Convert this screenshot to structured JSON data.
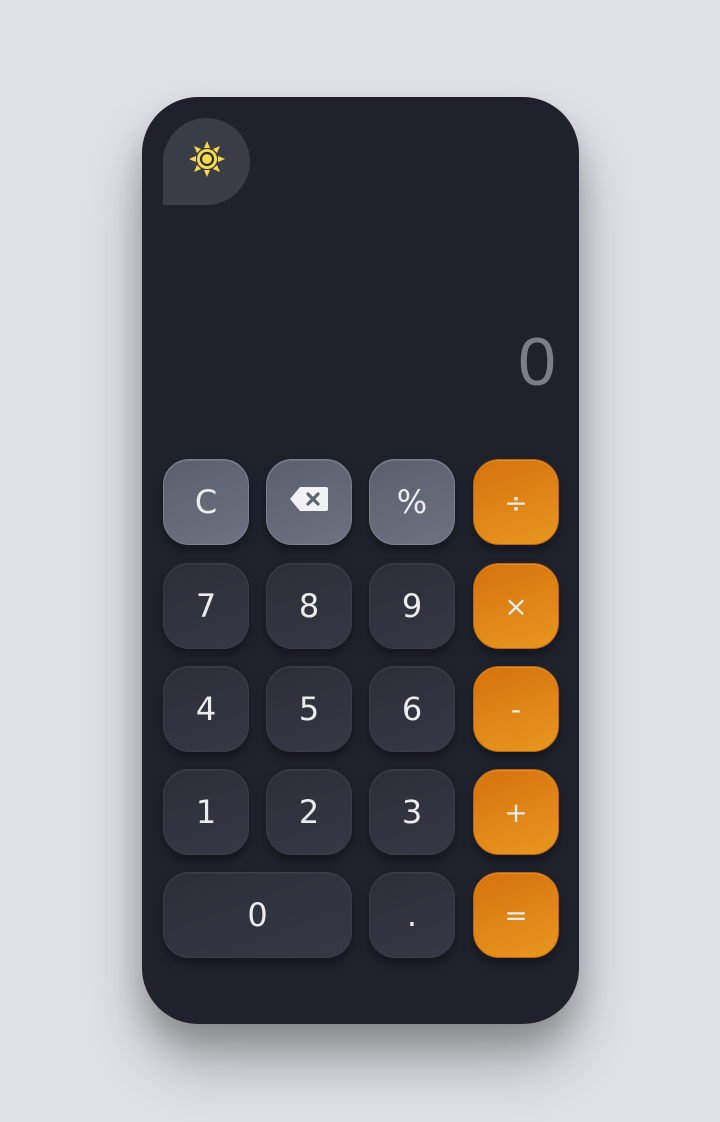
{
  "theme_toggle": {
    "icon": "sun-icon"
  },
  "display": {
    "value": "0"
  },
  "keys": {
    "clear": "C",
    "backspace_icon": "backspace-icon",
    "percent": "%",
    "divide": "÷",
    "seven": "7",
    "eight": "8",
    "nine": "9",
    "multiply": "×",
    "four": "4",
    "five": "5",
    "six": "6",
    "subtract": "-",
    "one": "1",
    "two": "2",
    "three": "3",
    "add": "+",
    "zero": "0",
    "decimal": ".",
    "equals": "="
  },
  "colors": {
    "background": "#e1e2e8",
    "body": "#1f222b",
    "number_key": "#31343e",
    "function_key": "#646977",
    "operator_key": "#e08a18",
    "sun": "#f7d94c",
    "display_text": "#7b7e86"
  }
}
